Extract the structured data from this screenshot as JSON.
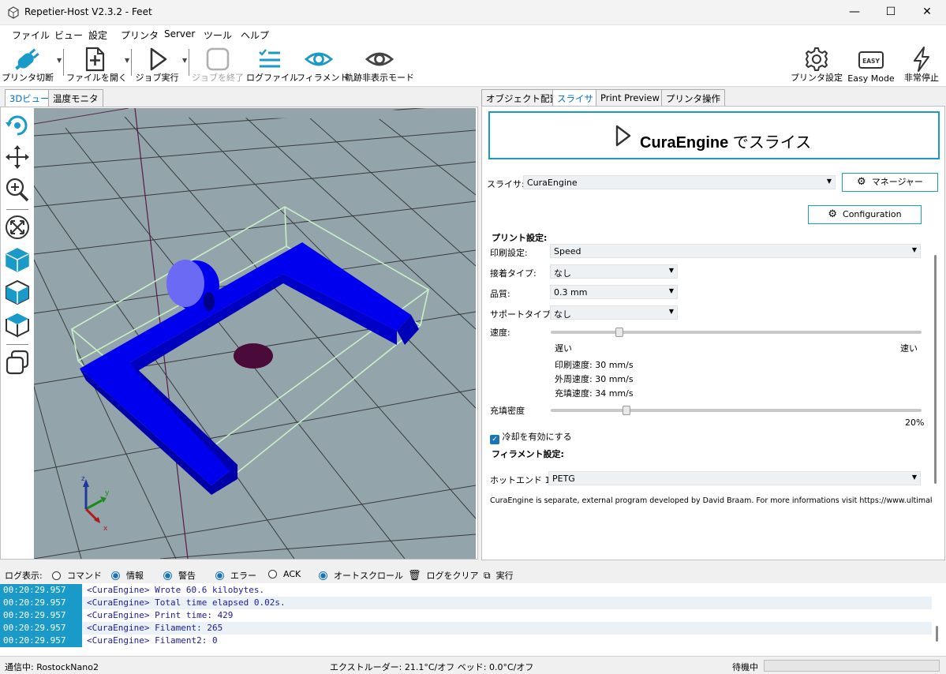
{
  "window": {
    "title": "Repetier-Host V2.3.2 - Feet",
    "minimize": "—",
    "maximize": "☐",
    "close": "✕"
  },
  "menu": [
    "ファイル",
    "ビュー",
    "設定",
    "プリンタ",
    "Server",
    "ツール",
    "ヘルプ"
  ],
  "toolbar": {
    "disconnect": "プリンタ切断",
    "open_file": "ファイルを開く",
    "run_job": "ジョブ実行",
    "end_job": "ジョブを終了",
    "log_file": "ログファイル",
    "filament": "フィラメント",
    "hide_travel": "軌跡非表示モード",
    "printer_settings": "プリンタ設定",
    "easy_mode": "Easy Mode",
    "easy_badge": "EASY",
    "emergency_stop": "非常停止"
  },
  "left_tabs": [
    "3Dビュー",
    "温度モニタ"
  ],
  "right_tabs": [
    "オブジェクト配置",
    "スライサ",
    "Print Preview",
    "プリンタ操作"
  ],
  "slicer": {
    "slice_button_bold": "CuraEngine",
    "slice_button_rest": " でスライス",
    "slicer_label": "スライサ:",
    "slicer_value": "CuraEngine",
    "manager_button": "マネージャー",
    "configuration_button": "Configuration",
    "print_settings_header": "プリント設定:",
    "print_setting_label": "印刷設定:",
    "print_setting_value": "Speed",
    "adhesion_label": "接着タイプ:",
    "adhesion_value": "なし",
    "quality_label": "品質:",
    "quality_value": "0.3 mm",
    "support_label": "サポートタイプ:",
    "support_value": "なし",
    "speed_label": "速度:",
    "speed_level": 0.18,
    "slow_label": "遅い",
    "fast_label": "速い",
    "print_speed": "印刷速度:   30 mm/s",
    "perimeter_speed": "外周速度:   30 mm/s",
    "infill_speed": "充填速度:   34 mm/s",
    "infill_label": "充填密度",
    "infill_percent": "20%",
    "cooling_label": "冷却を有効にする",
    "cooling_checked": true,
    "filament_header": "フィラメント設定:",
    "hotend_label": "ホットエンド 1:",
    "hotend_value": "PETG",
    "footer_note": "CuraEngine is separate, external program developed by David Braam. For more informations visit https://www.ultimaker."
  },
  "log_toolbar": {
    "label": "ログ表示:",
    "commands": "コマンド",
    "info": "情報",
    "warnings": "警告",
    "errors": "エラー",
    "ack": "ACK",
    "autoscroll": "オートスクロール",
    "clear": "ログをクリア",
    "run": "実行"
  },
  "log": [
    {
      "time": "00:20:29.957",
      "msg": "<CuraEngine> Wrote  60.6 kilobytes."
    },
    {
      "time": "00:20:29.957",
      "msg": "<CuraEngine> Total time elapsed  0.02s."
    },
    {
      "time": "00:20:29.957",
      "msg": "<CuraEngine> Print time: 429"
    },
    {
      "time": "00:20:29.957",
      "msg": "<CuraEngine> Filament: 265"
    },
    {
      "time": "00:20:29.957",
      "msg": "<CuraEngine> Filament2: 0"
    }
  ],
  "status": {
    "connection": "通信中: RostockNano2",
    "temps": "エクストルーダー: 21.1°C/オフ ベッド: 0.0°C/オフ",
    "state": "待機中"
  },
  "axes": {
    "x": "x",
    "y": "y",
    "z": "z"
  },
  "colors": {
    "accent": "#1a9ac9",
    "model": "#0000ee",
    "log_text": "#1a1aa6"
  }
}
